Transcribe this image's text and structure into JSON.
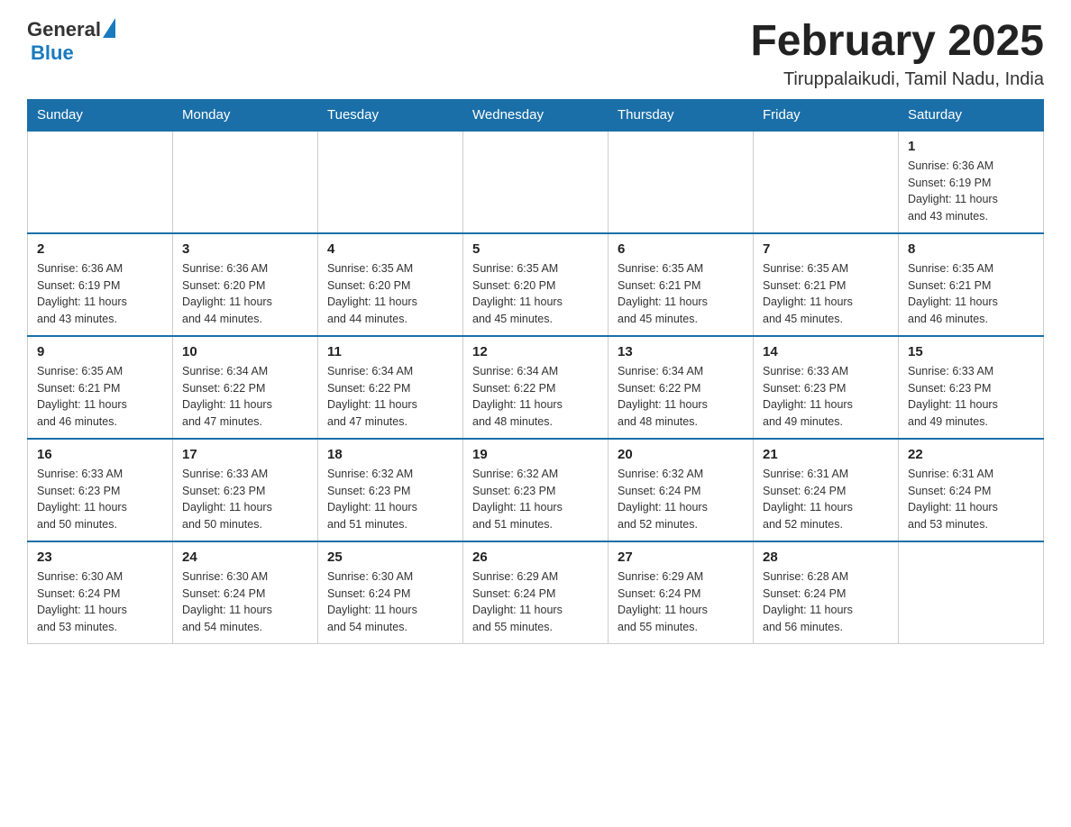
{
  "header": {
    "logo": {
      "general": "General",
      "blue": "Blue",
      "aria": "GeneralBlue logo"
    },
    "title": "February 2025",
    "location": "Tiruppalaikudi, Tamil Nadu, India"
  },
  "calendar": {
    "days_of_week": [
      "Sunday",
      "Monday",
      "Tuesday",
      "Wednesday",
      "Thursday",
      "Friday",
      "Saturday"
    ],
    "weeks": [
      [
        {
          "day": "",
          "info": ""
        },
        {
          "day": "",
          "info": ""
        },
        {
          "day": "",
          "info": ""
        },
        {
          "day": "",
          "info": ""
        },
        {
          "day": "",
          "info": ""
        },
        {
          "day": "",
          "info": ""
        },
        {
          "day": "1",
          "info": "Sunrise: 6:36 AM\nSunset: 6:19 PM\nDaylight: 11 hours\nand 43 minutes."
        }
      ],
      [
        {
          "day": "2",
          "info": "Sunrise: 6:36 AM\nSunset: 6:19 PM\nDaylight: 11 hours\nand 43 minutes."
        },
        {
          "day": "3",
          "info": "Sunrise: 6:36 AM\nSunset: 6:20 PM\nDaylight: 11 hours\nand 44 minutes."
        },
        {
          "day": "4",
          "info": "Sunrise: 6:35 AM\nSunset: 6:20 PM\nDaylight: 11 hours\nand 44 minutes."
        },
        {
          "day": "5",
          "info": "Sunrise: 6:35 AM\nSunset: 6:20 PM\nDaylight: 11 hours\nand 45 minutes."
        },
        {
          "day": "6",
          "info": "Sunrise: 6:35 AM\nSunset: 6:21 PM\nDaylight: 11 hours\nand 45 minutes."
        },
        {
          "day": "7",
          "info": "Sunrise: 6:35 AM\nSunset: 6:21 PM\nDaylight: 11 hours\nand 45 minutes."
        },
        {
          "day": "8",
          "info": "Sunrise: 6:35 AM\nSunset: 6:21 PM\nDaylight: 11 hours\nand 46 minutes."
        }
      ],
      [
        {
          "day": "9",
          "info": "Sunrise: 6:35 AM\nSunset: 6:21 PM\nDaylight: 11 hours\nand 46 minutes."
        },
        {
          "day": "10",
          "info": "Sunrise: 6:34 AM\nSunset: 6:22 PM\nDaylight: 11 hours\nand 47 minutes."
        },
        {
          "day": "11",
          "info": "Sunrise: 6:34 AM\nSunset: 6:22 PM\nDaylight: 11 hours\nand 47 minutes."
        },
        {
          "day": "12",
          "info": "Sunrise: 6:34 AM\nSunset: 6:22 PM\nDaylight: 11 hours\nand 48 minutes."
        },
        {
          "day": "13",
          "info": "Sunrise: 6:34 AM\nSunset: 6:22 PM\nDaylight: 11 hours\nand 48 minutes."
        },
        {
          "day": "14",
          "info": "Sunrise: 6:33 AM\nSunset: 6:23 PM\nDaylight: 11 hours\nand 49 minutes."
        },
        {
          "day": "15",
          "info": "Sunrise: 6:33 AM\nSunset: 6:23 PM\nDaylight: 11 hours\nand 49 minutes."
        }
      ],
      [
        {
          "day": "16",
          "info": "Sunrise: 6:33 AM\nSunset: 6:23 PM\nDaylight: 11 hours\nand 50 minutes."
        },
        {
          "day": "17",
          "info": "Sunrise: 6:33 AM\nSunset: 6:23 PM\nDaylight: 11 hours\nand 50 minutes."
        },
        {
          "day": "18",
          "info": "Sunrise: 6:32 AM\nSunset: 6:23 PM\nDaylight: 11 hours\nand 51 minutes."
        },
        {
          "day": "19",
          "info": "Sunrise: 6:32 AM\nSunset: 6:23 PM\nDaylight: 11 hours\nand 51 minutes."
        },
        {
          "day": "20",
          "info": "Sunrise: 6:32 AM\nSunset: 6:24 PM\nDaylight: 11 hours\nand 52 minutes."
        },
        {
          "day": "21",
          "info": "Sunrise: 6:31 AM\nSunset: 6:24 PM\nDaylight: 11 hours\nand 52 minutes."
        },
        {
          "day": "22",
          "info": "Sunrise: 6:31 AM\nSunset: 6:24 PM\nDaylight: 11 hours\nand 53 minutes."
        }
      ],
      [
        {
          "day": "23",
          "info": "Sunrise: 6:30 AM\nSunset: 6:24 PM\nDaylight: 11 hours\nand 53 minutes."
        },
        {
          "day": "24",
          "info": "Sunrise: 6:30 AM\nSunset: 6:24 PM\nDaylight: 11 hours\nand 54 minutes."
        },
        {
          "day": "25",
          "info": "Sunrise: 6:30 AM\nSunset: 6:24 PM\nDaylight: 11 hours\nand 54 minutes."
        },
        {
          "day": "26",
          "info": "Sunrise: 6:29 AM\nSunset: 6:24 PM\nDaylight: 11 hours\nand 55 minutes."
        },
        {
          "day": "27",
          "info": "Sunrise: 6:29 AM\nSunset: 6:24 PM\nDaylight: 11 hours\nand 55 minutes."
        },
        {
          "day": "28",
          "info": "Sunrise: 6:28 AM\nSunset: 6:24 PM\nDaylight: 11 hours\nand 56 minutes."
        },
        {
          "day": "",
          "info": ""
        }
      ]
    ]
  }
}
